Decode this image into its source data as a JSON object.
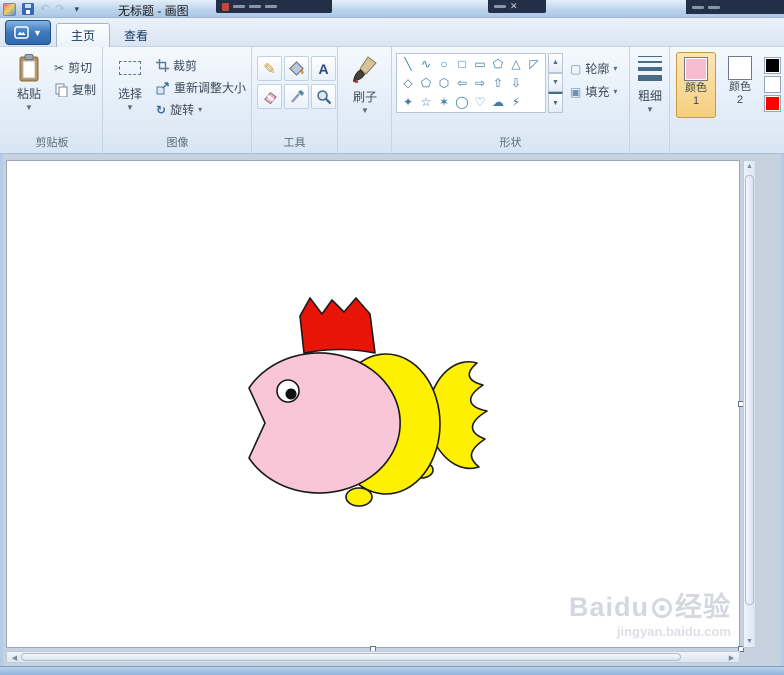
{
  "titlebar": {
    "title": "无标题 - 画图"
  },
  "tabs": {
    "home": "主页",
    "view": "查看"
  },
  "ribbon": {
    "clipboard": {
      "group_label": "剪贴板",
      "paste_label": "粘贴",
      "cut_label": "剪切",
      "copy_label": "复制"
    },
    "image": {
      "group_label": "图像",
      "select_label": "选择",
      "crop_label": "裁剪",
      "resize_label": "重新调整大小",
      "rotate_label": "旋转"
    },
    "tools": {
      "group_label": "工具",
      "text_tool_glyph": "A"
    },
    "brushes": {
      "button_label": "刷子"
    },
    "shapes": {
      "group_label": "形状",
      "outline_label": "轮廓",
      "fill_label": "填充",
      "gallery_row1": [
        "╲",
        "∿",
        "○",
        "□",
        "▭",
        "⬠",
        "△",
        "◸"
      ],
      "gallery_row2": [
        "◇",
        "⬠",
        "⬡",
        "⇦",
        "⇨",
        "⇧",
        "⇩"
      ],
      "gallery_row3": [
        "✦",
        "☆",
        "✶",
        "◯",
        "♡",
        "☁",
        "⚡"
      ]
    },
    "size": {
      "button_label": "粗细"
    },
    "colors": {
      "color1_label_line1": "颜色",
      "color1_label_line2": "1",
      "color2_label_line1": "颜色",
      "color2_label_line2": "2",
      "color1_value": "#f7bcd0",
      "color2_value": "#ffffff",
      "palette": [
        "#000000",
        "#ffffff",
        "#ff0000"
      ]
    }
  },
  "canvas": {
    "fish_colors": {
      "head": "#f9c6d8",
      "body": "#fdf000",
      "crown": "#e81408",
      "eye_white": "#ffffff",
      "eye_pupil": "#111111",
      "outline": "#1a1a1a"
    }
  },
  "watermark": {
    "brand": "Baidu",
    "suffix": "经验",
    "url": "jingyan.baidu.com"
  }
}
